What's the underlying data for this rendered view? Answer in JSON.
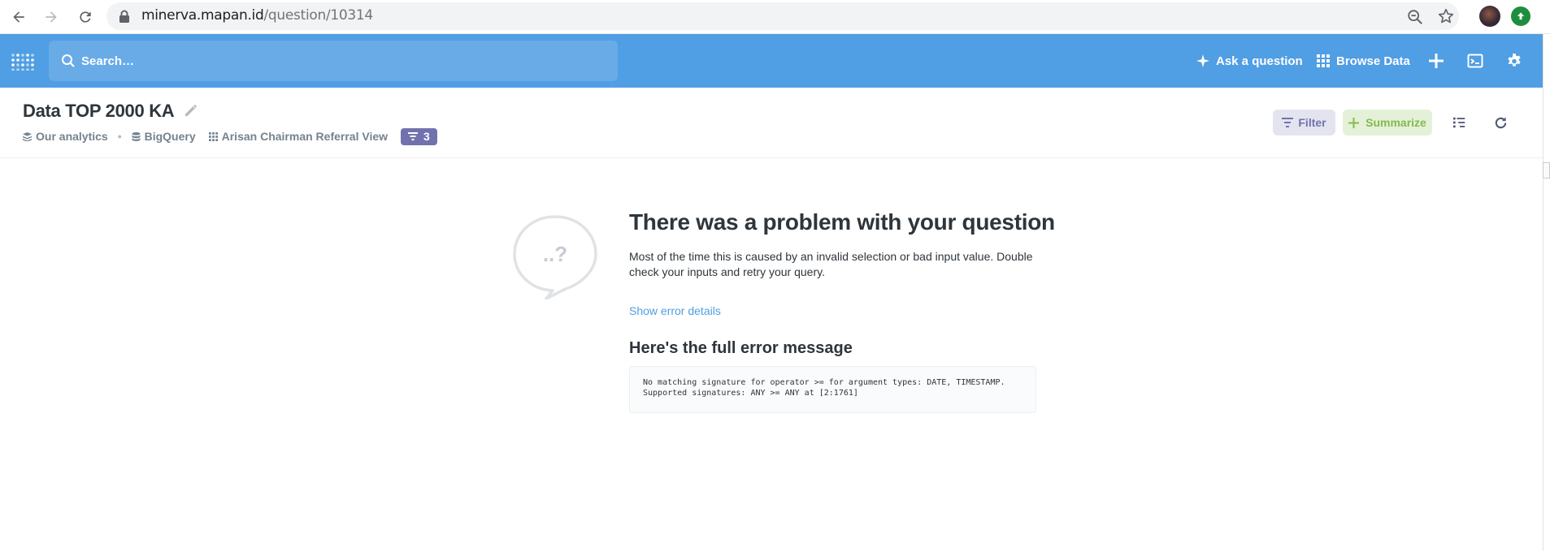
{
  "browser": {
    "url_domain": "minerva.mapan.id",
    "url_path": "/question/10314"
  },
  "nav": {
    "search_placeholder": "Search…",
    "ask_question": "Ask a question",
    "browse_data": "Browse Data"
  },
  "question": {
    "title": "Data TOP 2000 KA",
    "collection": "Our analytics",
    "database": "BigQuery",
    "table": "Arisan Chairman Referral View",
    "filter_count": "3",
    "filter_label": "Filter",
    "summarize_label": "Summarize"
  },
  "error": {
    "title": "There was a problem with your question",
    "description": "Most of the time this is caused by an invalid selection or bad input value. Double check your inputs and retry your query.",
    "show_details": "Show error details",
    "full_message_heading": "Here's the full error message",
    "message": "No matching signature for operator >= for argument types: DATE, TIMESTAMP.\nSupported signatures: ANY >= ANY at [2:1761]",
    "illustration_text": "..?"
  },
  "colors": {
    "brand": "#509ee3",
    "filter": "#7172ad",
    "summarize": "#84bb4c"
  }
}
